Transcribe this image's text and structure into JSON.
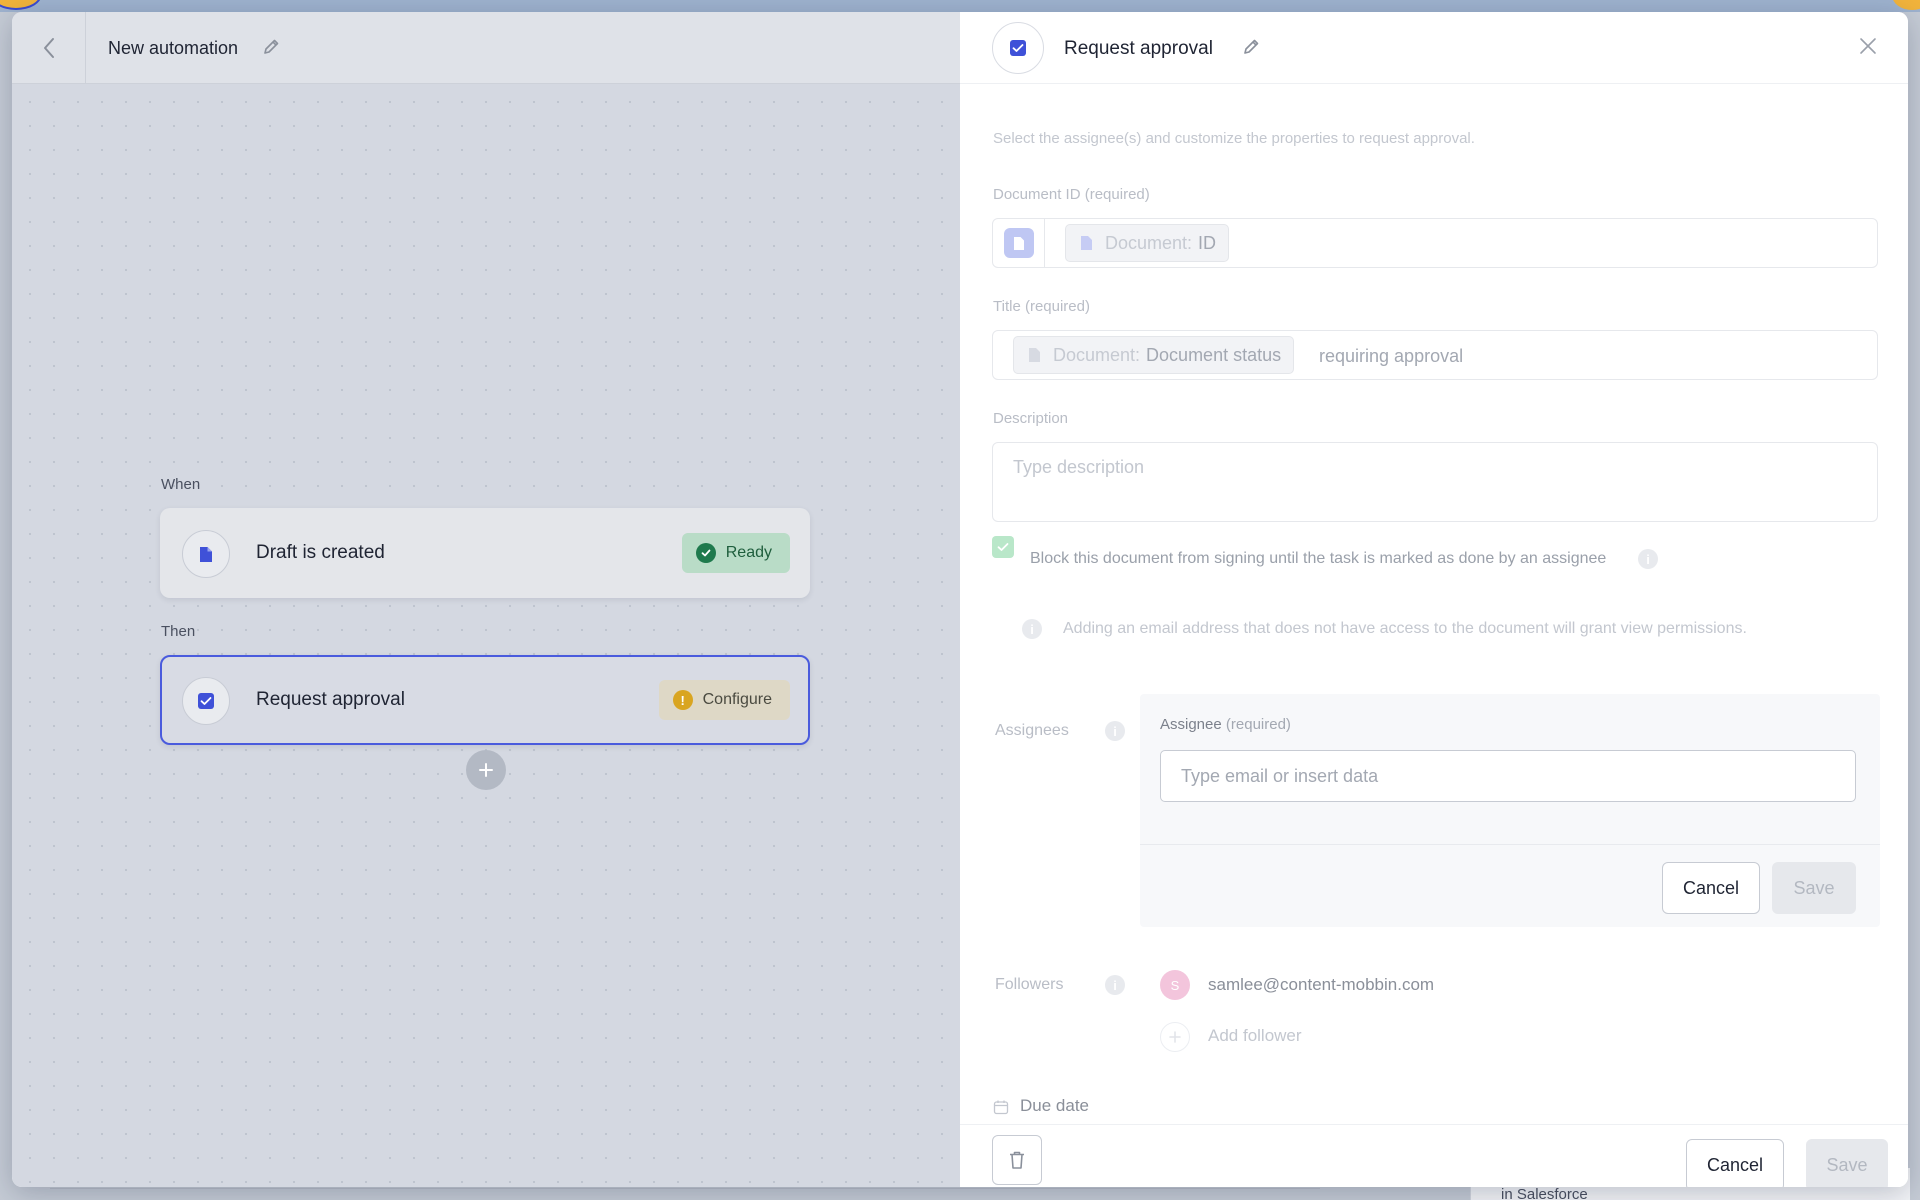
{
  "canvas": {
    "title": "New automation",
    "when_label": "When",
    "then_label": "Then",
    "trigger": {
      "label": "Draft is created",
      "status": "Ready"
    },
    "action": {
      "label": "Request approval",
      "status": "Configure"
    }
  },
  "panel": {
    "title": "Request approval",
    "intro": "Select the assignee(s) and customize the properties to request approval.",
    "document_id": {
      "label": "Document ID",
      "required": "(required)",
      "chip_prefix": "Document:",
      "chip_value": "ID"
    },
    "title_field": {
      "label": "Title",
      "required": "(required)",
      "chip_prefix": "Document:",
      "chip_value": "Document status",
      "suffix_text": "requiring approval"
    },
    "description": {
      "label": "Description",
      "placeholder": "Type description"
    },
    "block_option": {
      "checked": true,
      "label": "Block this document from signing until the task is marked as done by an assignee"
    },
    "email_notice": "Adding an email address that does not have access to the document will grant view permissions.",
    "assignees": {
      "label": "Assignees",
      "field_label": "Assignee",
      "field_required": "(required)",
      "placeholder": "Type email or insert data",
      "cancel": "Cancel",
      "save": "Save"
    },
    "followers": {
      "label": "Followers",
      "items": [
        {
          "initial": "S",
          "email": "samlee@content-mobbin.com"
        }
      ],
      "add_label": "Add follower"
    },
    "due_date_label": "Due date",
    "footer": {
      "cancel": "Cancel",
      "save": "Save"
    }
  },
  "background": {
    "peek_text": "in Salesforce"
  },
  "icons": {
    "back": "chevron-left-icon",
    "edit": "pencil-icon",
    "close": "close-icon",
    "document": "document-icon",
    "checkbox": "checkbox-icon",
    "ready": "check-circle-icon",
    "warning": "exclamation-circle-icon",
    "add": "plus-icon",
    "info": "info-icon",
    "calendar": "calendar-icon",
    "trash": "trash-icon"
  },
  "colors": {
    "accent": "#4a5bdd",
    "ready_bg": "#b9dcc7",
    "ready_fg": "#1f7a4d",
    "warning": "#d9a520",
    "follower_avatar": "#f3c5dc"
  }
}
